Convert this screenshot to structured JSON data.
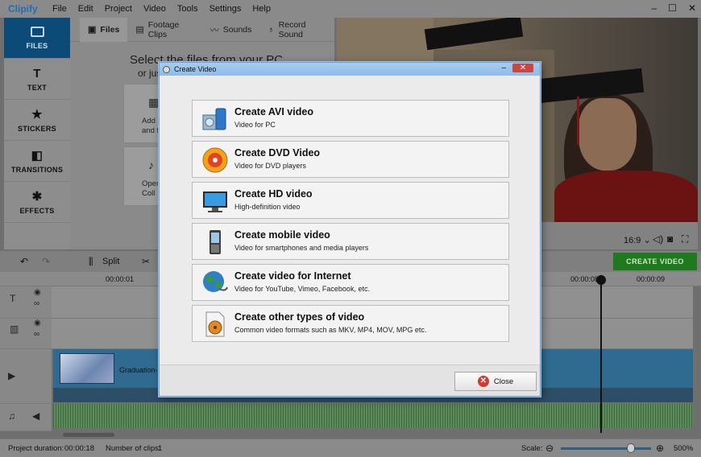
{
  "app": {
    "logo": "Clipify",
    "menu": [
      "File",
      "Edit",
      "Project",
      "Video",
      "Tools",
      "Settings",
      "Help"
    ],
    "window_controls": [
      "–",
      "☐",
      "✕"
    ]
  },
  "sidebar": {
    "items": [
      {
        "label": "FILES",
        "icon": "files-icon",
        "active": true
      },
      {
        "label": "TEXT",
        "icon": "text-icon"
      },
      {
        "label": "STICKERS",
        "icon": "star-icon"
      },
      {
        "label": "TRANSITIONS",
        "icon": "transitions-icon"
      },
      {
        "label": "EFFECTS",
        "icon": "magic-wand-icon"
      }
    ]
  },
  "media_tabs": [
    {
      "label": "Files",
      "icon": "image-icon"
    },
    {
      "label": "Footage Clips",
      "icon": "film-icon"
    },
    {
      "label": "Sounds",
      "icon": "waveform-icon"
    },
    {
      "label": "Record Sound",
      "icon": "microphone-icon"
    }
  ],
  "media_panel": {
    "heading": "Select the files from your PC",
    "sub": "or jus",
    "card1": [
      "Add",
      "and f"
    ],
    "card2": [
      "Oper",
      "Coll"
    ]
  },
  "preview": {
    "aspect_ratio": "16:9 ⌄"
  },
  "toolbar": {
    "split_label": "Split",
    "create_video_label": "CREATE VIDEO",
    "accent": "#1f7a1f"
  },
  "timeline": {
    "ruler_labels": [
      "00:00:01",
      "00:00:08",
      "00:00:09"
    ],
    "clip_name": "Graduation-("
  },
  "status": {
    "duration_label": "Project duration:",
    "duration_value": "00:00:18",
    "clips_label": "Number of clips:",
    "clips_value": "1",
    "scale_label": "Scale:",
    "zoom_value": "500%",
    "zoom_fraction": 0.78
  },
  "dialog": {
    "title": "Create Video",
    "title_controls": [
      "–",
      "✕"
    ],
    "options": [
      {
        "title": "Create AVI video",
        "subtitle": "Video for PC",
        "icon": "avi-video-icon"
      },
      {
        "title": "Create DVD Video",
        "subtitle": "Video for DVD players",
        "icon": "dvd-disc-icon"
      },
      {
        "title": "Create HD video",
        "subtitle": "High-definition video",
        "icon": "hd-monitor-icon"
      },
      {
        "title": "Create mobile video",
        "subtitle": "Video for smartphones and media players",
        "icon": "mobile-phone-icon"
      },
      {
        "title": "Create video for Internet",
        "subtitle": "Video for YouTube, Vimeo, Facebook, etc.",
        "icon": "globe-icon"
      },
      {
        "title": "Create other types of video",
        "subtitle": "Common video formats such as MKV, MP4, MOV, MPG etc.",
        "icon": "film-reel-file-icon"
      }
    ],
    "close_label": "Close"
  }
}
